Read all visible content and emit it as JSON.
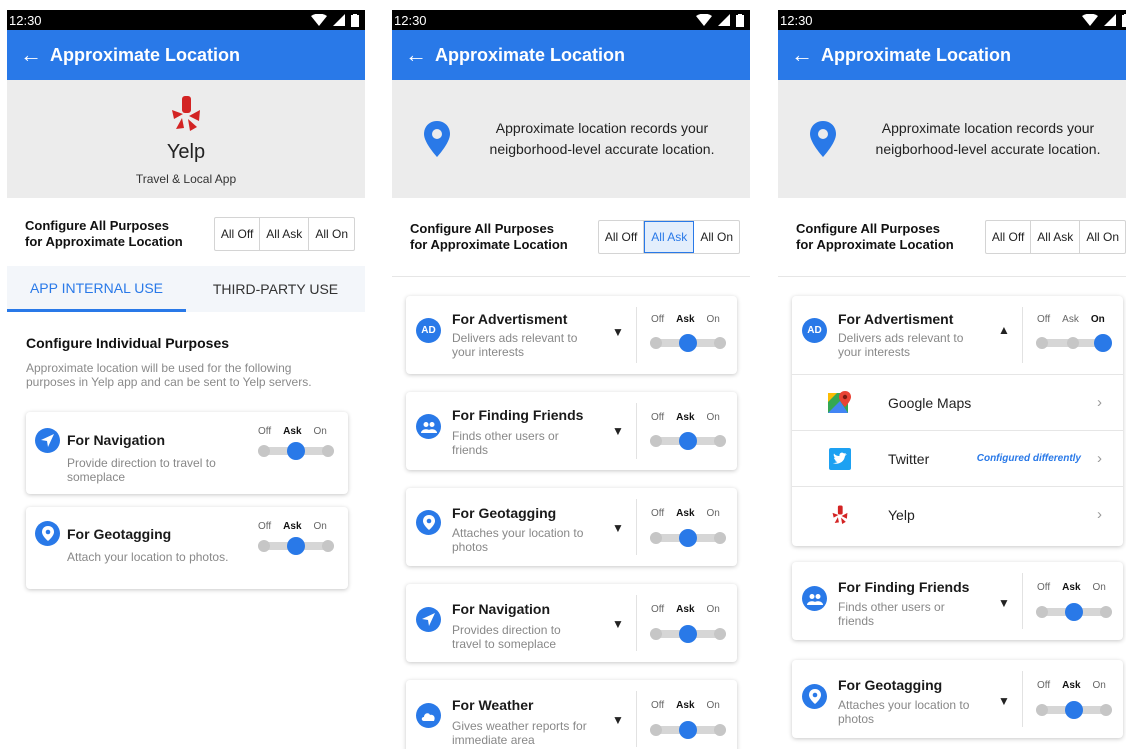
{
  "status_time": "12:30",
  "header_title": "Approximate Location",
  "panel1": {
    "app_name": "Yelp",
    "app_category": "Travel & Local App",
    "config_label_line1": "Configure All Purposes",
    "config_label_line2": "for Approximate Location",
    "config_options": [
      "All Off",
      "All Ask",
      "All On"
    ],
    "tabs": [
      "APP INTERNAL USE",
      "THIRD-PARTY USE"
    ],
    "individual_heading": "Configure Individual Purposes",
    "individual_desc_line1": "Approximate location will be used for the following",
    "individual_desc_line2": "purposes in Yelp app and can be sent to Yelp servers.",
    "purposes": [
      {
        "title": "For Navigation",
        "desc_line1": "Provide direction to travel to",
        "desc_line2": "someplace",
        "icon": "navigation-icon",
        "state": "Ask"
      },
      {
        "title": "For Geotagging",
        "desc_line1": "Attach your location to photos.",
        "desc_line2": "",
        "icon": "location-pin-icon",
        "state": "Ask"
      }
    ]
  },
  "panel2": {
    "info_line1": "Approximate location records your",
    "info_line2": "neigborhood-level accurate location.",
    "config_label_line1": "Configure All Purposes",
    "config_label_line2": "for Approximate Location",
    "config_options": [
      "All Off",
      "All Ask",
      "All On"
    ],
    "selected_option": "All Ask",
    "purposes": [
      {
        "title": "For Advertisment",
        "desc_line1": "Delivers ads relevant to",
        "desc_line2": "your interests",
        "icon": "ad-icon",
        "icon_text": "AD",
        "state": "Ask"
      },
      {
        "title": "For Finding Friends",
        "desc_line1": "Finds other users or",
        "desc_line2": "friends",
        "icon": "people-icon",
        "state": "Ask"
      },
      {
        "title": "For Geotagging",
        "desc_line1": "Attaches your location to",
        "desc_line2": "photos",
        "icon": "location-pin-icon",
        "state": "Ask"
      },
      {
        "title": "For Navigation",
        "desc_line1": "Provides direction to",
        "desc_line2": "travel to someplace",
        "icon": "navigation-icon",
        "state": "Ask"
      },
      {
        "title": "For Weather",
        "desc_line1": "Gives weather reports for",
        "desc_line2": "immediate area",
        "icon": "cloud-icon",
        "state": "Ask"
      }
    ]
  },
  "panel3": {
    "info_line1": "Approximate location records your",
    "info_line2": "neigborhood-level accurate location.",
    "config_label_line1": "Configure All Purposes",
    "config_label_line2": "for Approximate Location",
    "config_options": [
      "All Off",
      "All Ask",
      "All On"
    ],
    "ad_purpose": {
      "title": "For Advertisment",
      "desc_line1": "Delivers ads relevant to",
      "desc_line2": "your interests",
      "icon_text": "AD",
      "state": "On"
    },
    "apps": [
      {
        "name": "Google Maps",
        "icon": "google-maps-icon",
        "note": ""
      },
      {
        "name": "Twitter",
        "icon": "twitter-icon",
        "note": "Configured differently"
      },
      {
        "name": "Yelp",
        "icon": "yelp-icon",
        "note": ""
      }
    ],
    "purposes": [
      {
        "title": "For Finding Friends",
        "desc_line1": "Finds other users or",
        "desc_line2": "friends",
        "icon": "people-icon",
        "state": "Ask"
      },
      {
        "title": "For Geotagging",
        "desc_line1": "Attaches your location to",
        "desc_line2": "photos",
        "icon": "location-pin-icon",
        "state": "Ask"
      }
    ]
  },
  "toggle_labels": [
    "Off",
    "Ask",
    "On"
  ],
  "colors": {
    "primary": "#2979e8",
    "yelp_red": "#d32323",
    "twitter_blue": "#1da1f2",
    "hero_bg": "#ececec"
  }
}
